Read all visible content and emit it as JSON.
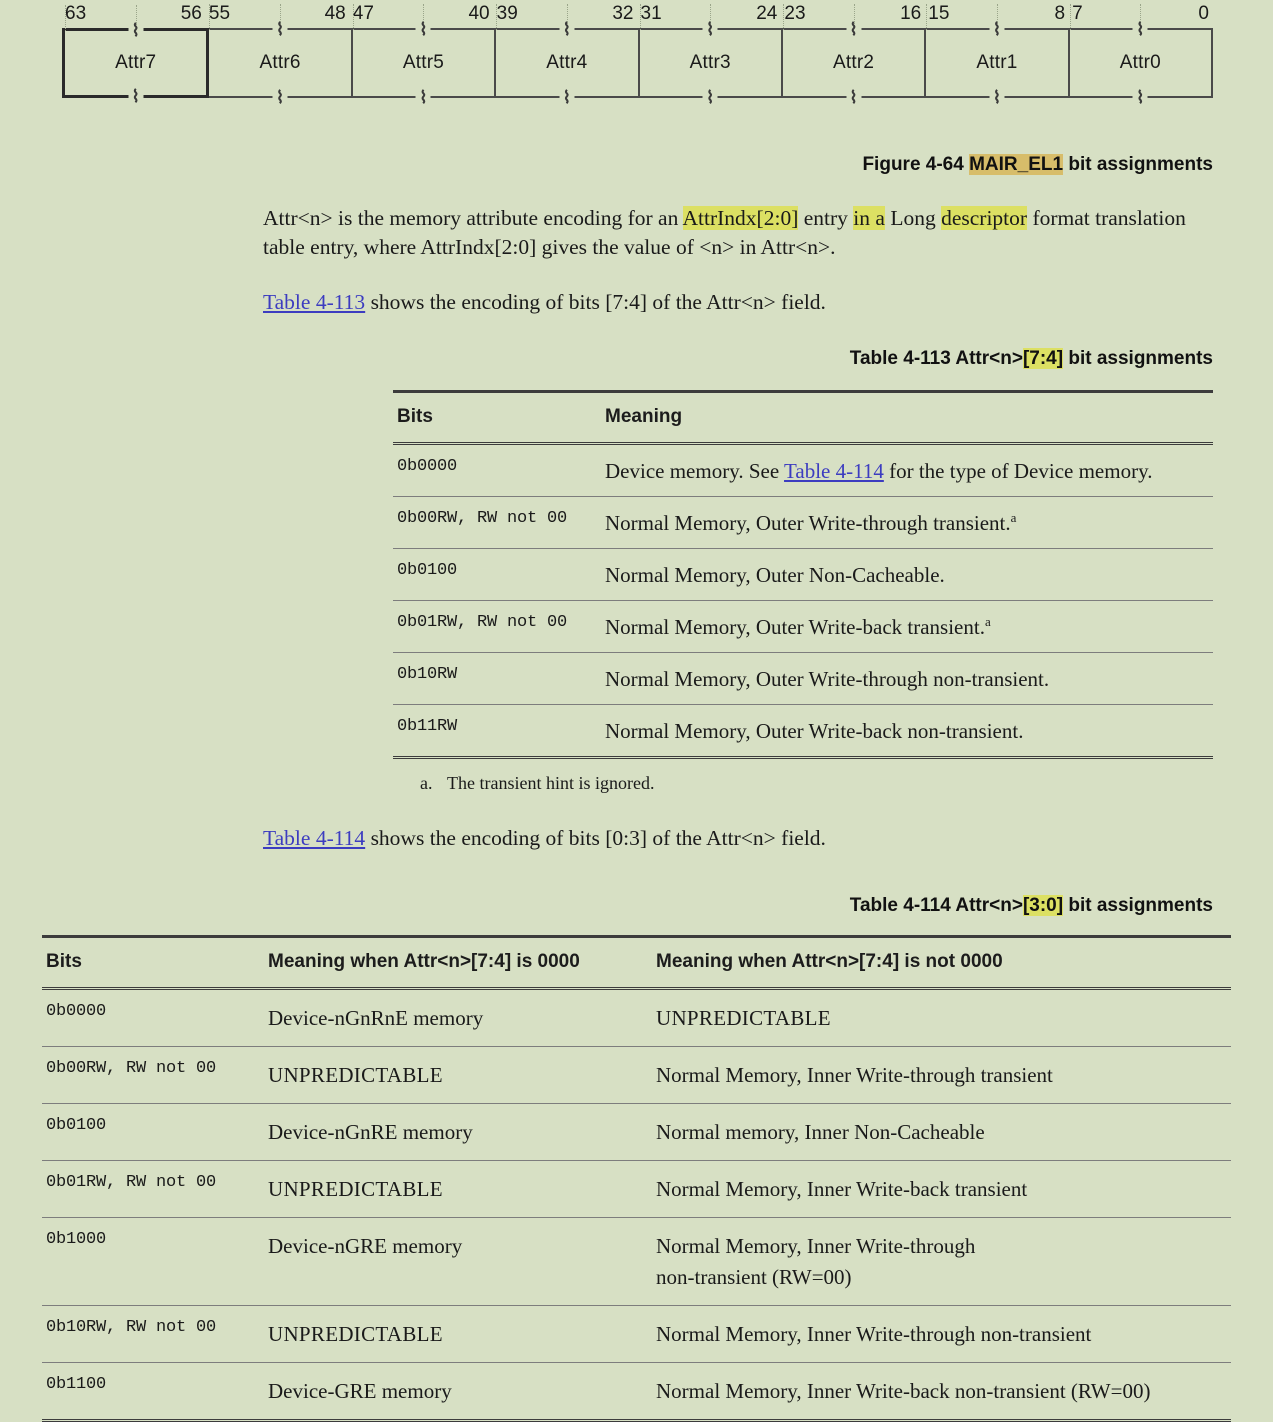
{
  "figure": {
    "bit_numbers": [
      {
        "left": "63",
        "right": "56"
      },
      {
        "left": "55",
        "right": "48"
      },
      {
        "left": "47",
        "right": "40"
      },
      {
        "left": "39",
        "right": "32"
      },
      {
        "left": "31",
        "right": "24"
      },
      {
        "left": "23",
        "right": "16"
      },
      {
        "left": "15",
        "right": "8"
      },
      {
        "left": "7",
        "right": "0"
      }
    ],
    "fields": [
      "Attr7",
      "Attr6",
      "Attr5",
      "Attr4",
      "Attr3",
      "Attr2",
      "Attr1",
      "Attr0"
    ],
    "break_glyph": "⌇",
    "caption_prefix": "Figure 4-64 ",
    "caption_highlight": "MAIR_EL1",
    "caption_suffix": " bit assignments"
  },
  "body": {
    "para1_a": "Attr<n> is the memory attribute encoding for an ",
    "para1_hl1": "AttrIndx[2:0]",
    "para1_b": " entry ",
    "para1_hl2": "in a",
    "para1_c": " Long ",
    "para1_hl3": "descriptor",
    "para1_d": " format translation table entry, where AttrIndx[2:0] gives the value of <n> in Attr<n>.",
    "intro113_link": "Table 4-113",
    "intro113_rest": " shows the encoding of bits [7:4] of the Attr<n> field.",
    "intro114_link": "Table 4-114",
    "intro114_rest": " shows the encoding of bits [0:3] of the Attr<n> field."
  },
  "table113": {
    "caption_prefix": "Table 4-113 Attr<n>",
    "caption_highlight": "[7:4]",
    "caption_suffix": " bit assignments",
    "headers": [
      "Bits",
      "Meaning"
    ],
    "rows": [
      {
        "bits": "0b0000",
        "meaning_pre": "Device memory. See ",
        "meaning_link": "Table 4-114",
        "meaning_post": " for the type of Device memory.",
        "footnote": ""
      },
      {
        "bits": "0b00RW, RW not 00",
        "meaning_pre": "Normal Memory, Outer Write-through transient.",
        "meaning_link": "",
        "meaning_post": "",
        "footnote": "a"
      },
      {
        "bits": "0b0100",
        "meaning_pre": "Normal Memory, Outer Non-Cacheable.",
        "meaning_link": "",
        "meaning_post": "",
        "footnote": ""
      },
      {
        "bits": "0b01RW, RW not 00",
        "meaning_pre": "Normal Memory, Outer Write-back transient.",
        "meaning_link": "",
        "meaning_post": "",
        "footnote": "a"
      },
      {
        "bits": "0b10RW",
        "meaning_pre": "Normal Memory, Outer Write-through non-transient.",
        "meaning_link": "",
        "meaning_post": "",
        "footnote": ""
      },
      {
        "bits": "0b11RW",
        "meaning_pre": "Normal Memory, Outer Write-back non-transient.",
        "meaning_link": "",
        "meaning_post": "",
        "footnote": ""
      }
    ],
    "footnote_mark": "a.",
    "footnote_text": "The transient hint is ignored."
  },
  "table114": {
    "caption_prefix": "Table 4-114 Attr<n>",
    "caption_highlight": "[3:0]",
    "caption_suffix": " bit assignments",
    "headers": [
      "Bits",
      "Meaning when Attr<n>[7:4] is 0000",
      "Meaning when Attr<n>[7:4] is not 0000"
    ],
    "rows": [
      {
        "bits": "0b0000",
        "col2": "Device-nGnRnE memory",
        "col2_sc": false,
        "col3": "UNPREDICTABLE",
        "col3_sc": true
      },
      {
        "bits": "0b00RW, RW not 00",
        "col2": "UNPREDICTABLE",
        "col2_sc": true,
        "col3": "Normal Memory, Inner Write-through transient",
        "col3_sc": false
      },
      {
        "bits": "0b0100",
        "col2": "Device-nGnRE memory",
        "col2_sc": false,
        "col3": "Normal memory, Inner Non-Cacheable",
        "col3_sc": false
      },
      {
        "bits": "0b01RW, RW not 00",
        "col2": "UNPREDICTABLE",
        "col2_sc": true,
        "col3": "Normal Memory, Inner Write-back transient",
        "col3_sc": false
      },
      {
        "bits": "0b1000",
        "col2": "Device-nGRE memory",
        "col2_sc": false,
        "col3": "Normal Memory, Inner Write-through\nnon-transient (RW=00)",
        "col3_sc": false
      },
      {
        "bits": "0b10RW, RW not 00",
        "col2": "UNPREDICTABLE",
        "col2_sc": true,
        "col3": "Normal Memory, Inner Write-through non-transient",
        "col3_sc": false
      },
      {
        "bits": "0b1100",
        "col2": "Device-GRE memory",
        "col2_sc": false,
        "col3": "Normal Memory, Inner Write-back non-transient (RW=00)",
        "col3_sc": false
      }
    ]
  },
  "colors": {
    "page_background": "#d7e0c4",
    "highlight_yellow": "#dce063",
    "highlight_gold": "#d7bd6a",
    "xref_link": "#3c3cc0",
    "rule": "#3c3c3c"
  }
}
